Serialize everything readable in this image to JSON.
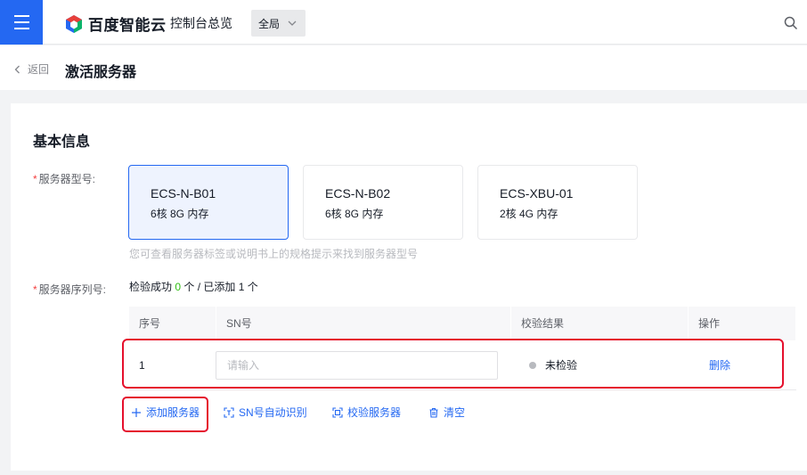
{
  "topbar": {
    "brand": "百度智能云",
    "console": "控制台总览",
    "region": "全局"
  },
  "page": {
    "back": "返回",
    "title": "激活服务器"
  },
  "form": {
    "section_title": "基本信息",
    "model_label": "服务器型号:",
    "models": [
      {
        "name": "ECS-N-B01",
        "spec": "6核 8G 内存",
        "selected": true
      },
      {
        "name": "ECS-N-B02",
        "spec": "6核 8G 内存",
        "selected": false
      },
      {
        "name": "ECS-XBU-01",
        "spec": "2核 4G 内存",
        "selected": false
      }
    ],
    "model_hint": "您可查看服务器标签或说明书上的规格提示来找到服务器型号",
    "sn_label": "服务器序列号:",
    "verify": {
      "prefix": "检验成功",
      "success_count": "0",
      "middle": "个 / 已添加",
      "added_count": "1",
      "suffix": "个"
    }
  },
  "table": {
    "headers": [
      "序号",
      "SN号",
      "校验结果",
      "操作"
    ],
    "rows": [
      {
        "index": "1",
        "sn_value": "",
        "sn_placeholder": "请输入",
        "status": "未检验",
        "action": "删除"
      }
    ]
  },
  "actions": {
    "add": "添加服务器",
    "auto_detect": "SN号自动识别",
    "verify": "校验服务器",
    "clear": "清空"
  },
  "colors": {
    "primary": "#2468f2",
    "success": "#30bf13",
    "required": "#f33e3e",
    "annotation": "#e5102d"
  }
}
